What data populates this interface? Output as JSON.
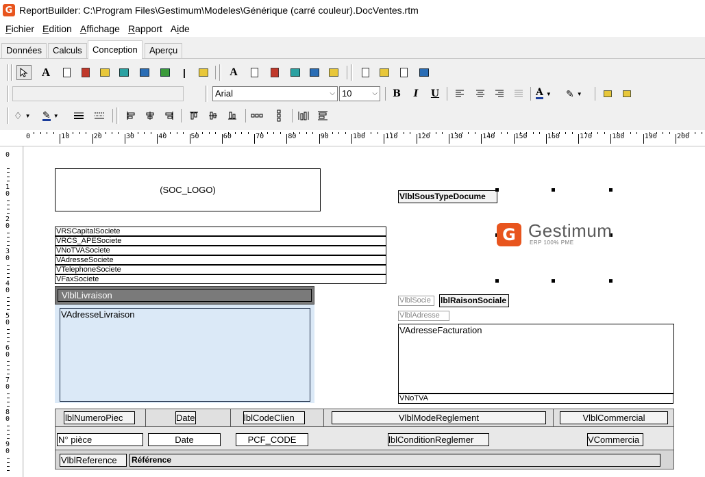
{
  "window": {
    "title": "ReportBuilder: C:\\Program Files\\Gestimum\\Modeles\\Générique (carré couleur).DocVentes.rtm",
    "app_icon_letter": "G"
  },
  "menu": [
    {
      "label": "Fichier",
      "key": "F"
    },
    {
      "label": "Edition",
      "key": "E"
    },
    {
      "label": "Affichage",
      "key": "A"
    },
    {
      "label": "Rapport",
      "key": "R"
    },
    {
      "label": "Aide",
      "key": "i"
    }
  ],
  "tabs": [
    {
      "label": "Données",
      "active": false
    },
    {
      "label": "Calculs",
      "active": false
    },
    {
      "label": "Conception",
      "active": true
    },
    {
      "label": "Aperçu",
      "active": false
    }
  ],
  "toolbar": {
    "font_name": "Arial",
    "font_size": "10",
    "bold_label": "B",
    "italic_label": "I",
    "underline_label": "U",
    "text_color_label": "A",
    "text_tool_label": "A",
    "component_combo": ""
  },
  "ruler": {
    "h_ticks": [
      "0",
      "10",
      "20",
      "30",
      "40",
      "50",
      "60",
      "70",
      "80",
      "90",
      "100",
      "110",
      "120",
      "130",
      "140",
      "150",
      "160",
      "170",
      "180",
      "190",
      "200"
    ],
    "v_ticks": [
      "0",
      "1\n0",
      "2\n0",
      "3\n0",
      "4\n0",
      "5\n0",
      "6\n0",
      "7\n0",
      "8\n0",
      "9\n0"
    ]
  },
  "design": {
    "soc_logo": "(SOC_LOGO)",
    "sous_type": "VlblSousTypeDocume",
    "company_fields": [
      "VRSCapitalSociete",
      "VRCS_APESociete",
      "VNoTVASociete",
      "VAdresseSociete",
      "VTelephoneSociete",
      "VFaxSociete"
    ],
    "livraison_label": "VlblLivraison",
    "adresse_livraison": "VAdresseLivraison",
    "brand": {
      "name": "Gestimum",
      "tagline": "ERP 100% PME",
      "logo_letter": "G",
      "color": "#e8551e"
    },
    "lbl_societe": "VlblSocie",
    "lbl_raison": "lblRaisonSociale",
    "lbl_adresse": "VlblAdresse",
    "adresse_facturation": "VAdresseFacturation",
    "notva": "VNoTVA",
    "header_row": {
      "numero": "lblNumeroPiec",
      "date": "Date",
      "code_client": "lblCodeClien",
      "mode_reglement": "VlblModeReglement",
      "commercial": "VlblCommercial"
    },
    "value_row": {
      "piece": "N° pièce",
      "date": "Date",
      "pcf_code": "PCF_CODE",
      "condition": "lblConditionReglemer",
      "commercial": "VCommercia"
    },
    "reference_row": {
      "label": "VlblReference",
      "value": "Référence"
    }
  }
}
